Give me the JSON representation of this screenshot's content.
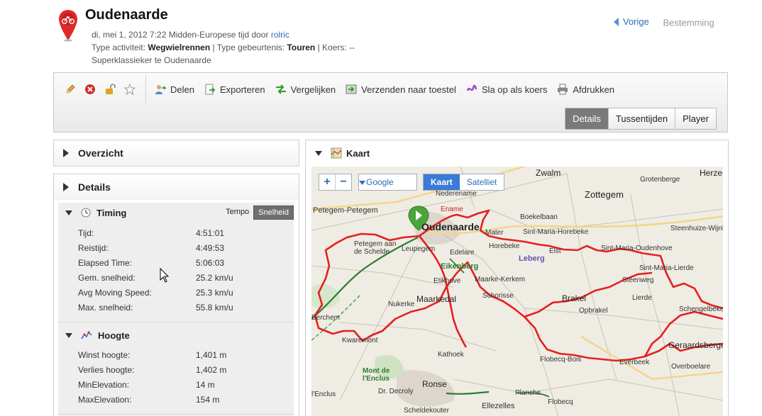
{
  "activity": {
    "title": "Oudenaarde",
    "date_prefix": "di, mei 1, 2012 7:22 Midden-Europese tijd door ",
    "user": "rolric",
    "type_label": "Type activiteit: ",
    "type_value": "Wegwielrennen",
    "event_label": " | Type gebeurtenis: ",
    "event_value": "Touren",
    "course_label": " | Koers: --",
    "description": "Superklassieker te Oudenaarde"
  },
  "nav": {
    "prev": "Vorige",
    "next": "Bestemming"
  },
  "toolbar": {
    "actions": [
      {
        "label": "Delen",
        "icon": "share-icon"
      },
      {
        "label": "Exporteren",
        "icon": "export-icon"
      },
      {
        "label": "Vergelijken",
        "icon": "compare-icon"
      },
      {
        "label": "Verzenden naar toestel",
        "icon": "send-device-icon"
      },
      {
        "label": "Sla op als koers",
        "icon": "save-course-icon"
      },
      {
        "label": "Afdrukken",
        "icon": "print-icon"
      }
    ],
    "tabs": [
      "Details",
      "Tussentijden",
      "Player"
    ],
    "active_tab": "Details"
  },
  "panels": {
    "overview": "Overzicht",
    "details": "Details",
    "map": "Kaart"
  },
  "timing": {
    "title": "Timing",
    "toggle": [
      "Tempo",
      "Snelheid"
    ],
    "rows": [
      {
        "label": "Tijd:",
        "value": "4:51:01"
      },
      {
        "label": "Reistijd:",
        "value": "4:49:53"
      },
      {
        "label": "Elapsed Time:",
        "value": "5:06:03"
      },
      {
        "label": "Gem. snelheid:",
        "value": "25.2 km/u"
      },
      {
        "label": "Avg Moving Speed:",
        "value": "25.3 km/u"
      },
      {
        "label": "Max. snelheid:",
        "value": "55.8 km/u"
      }
    ]
  },
  "elevation": {
    "title": "Hoogte",
    "rows": [
      {
        "label": "Winst hoogte:",
        "value": "1,401 m"
      },
      {
        "label": "Verlies hoogte:",
        "value": "1,402 m"
      },
      {
        "label": "MinElevation:",
        "value": "14 m"
      },
      {
        "label": "MaxElevation:",
        "value": "154 m"
      }
    ]
  },
  "map": {
    "zoom_in": "+",
    "zoom_out": "−",
    "provider": "Google",
    "types": [
      "Kaart",
      "Satelliet"
    ],
    "active_type": "Kaart",
    "places": [
      "Zwalm",
      "Herze",
      "Grotenberge",
      "Zottegem",
      "Nederename",
      "Ename",
      "Petegem-Petegem",
      "Oudenaarde",
      "Boekelbaan",
      "Mater",
      "Sint-Maria-Horebeke",
      "Steenhuize-Wijnhuize",
      "Petegem aan de Schelde",
      "Leupegem",
      "Edelare",
      "Horebeke",
      "Elst",
      "Sint-Maria-Oudenhove",
      "Leberg",
      "Eikenberg",
      "Sint-Maria-Lierde",
      "Steenweg",
      "Etikhove",
      "Maarke-Kerkem",
      "Schorisse",
      "Brakel",
      "Lierde",
      "Maarkedal",
      "Nukerke",
      "Opbrakel",
      "Schengelbeke",
      "Berchem",
      "Kwaremont",
      "Geraardsbergen",
      "Kathoek",
      "Flobecq-Bois",
      "Everbeek",
      "Overboelare",
      "Mont de l'Enclus",
      "Ronse",
      "Dr. Decroly",
      "Planche",
      "Flobecq",
      "l'Enclus",
      "Ellezelles",
      "Scheldekouter"
    ]
  },
  "colors": {
    "accent": "#2a6db5",
    "route": "#e52020",
    "active_tab": "#7a7a7a"
  }
}
